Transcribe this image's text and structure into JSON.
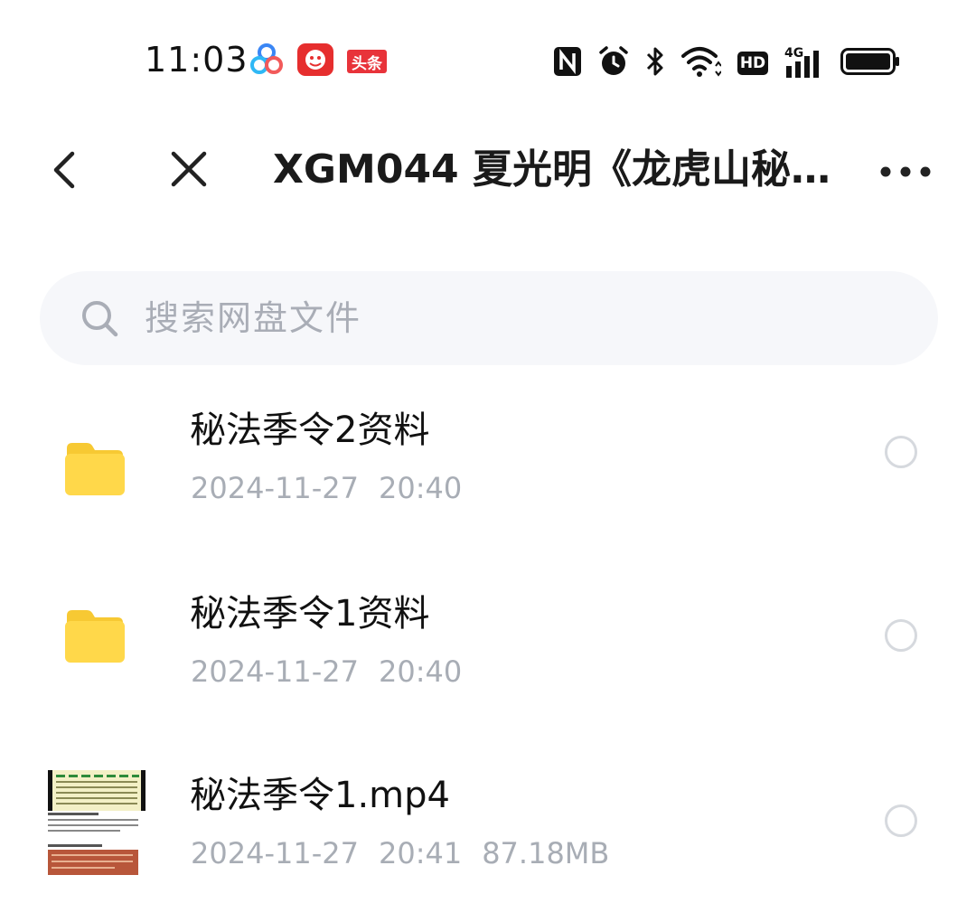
{
  "status_bar": {
    "time": "11:03",
    "app_icons": [
      "baidu-netdisk-icon",
      "jd-icon",
      "toutiao-icon"
    ],
    "toutiao_label": "头条",
    "system_icons": [
      "nfc-icon",
      "alarm-icon",
      "bluetooth-icon",
      "wifi-icon",
      "hd-icon",
      "signal-4g-icon",
      "battery-icon"
    ],
    "hd_label": "HD",
    "network_label": "4G"
  },
  "nav": {
    "title": "XGM044 夏光明《龙虎山秘…",
    "back_icon": "chevron-left-icon",
    "close_icon": "close-icon",
    "more_icon": "more-horizontal-icon"
  },
  "search": {
    "placeholder": "搜索网盘文件",
    "icon": "search-icon"
  },
  "files": [
    {
      "name": "秘法季令2资料",
      "date": "2024-11-27",
      "time": "20:40",
      "size": "",
      "type": "folder"
    },
    {
      "name": "秘法季令1资料",
      "date": "2024-11-27",
      "time": "20:40",
      "size": "",
      "type": "folder"
    },
    {
      "name": "秘法季令1.mp4",
      "date": "2024-11-27",
      "time": "20:41",
      "size": "87.18MB",
      "type": "video"
    }
  ],
  "colors": {
    "folder": "#ffd84a",
    "folder_dark": "#f7c933",
    "meta_text": "#a8adb5",
    "search_bg": "#f6f7fa",
    "radio_border": "#d6d9de"
  }
}
